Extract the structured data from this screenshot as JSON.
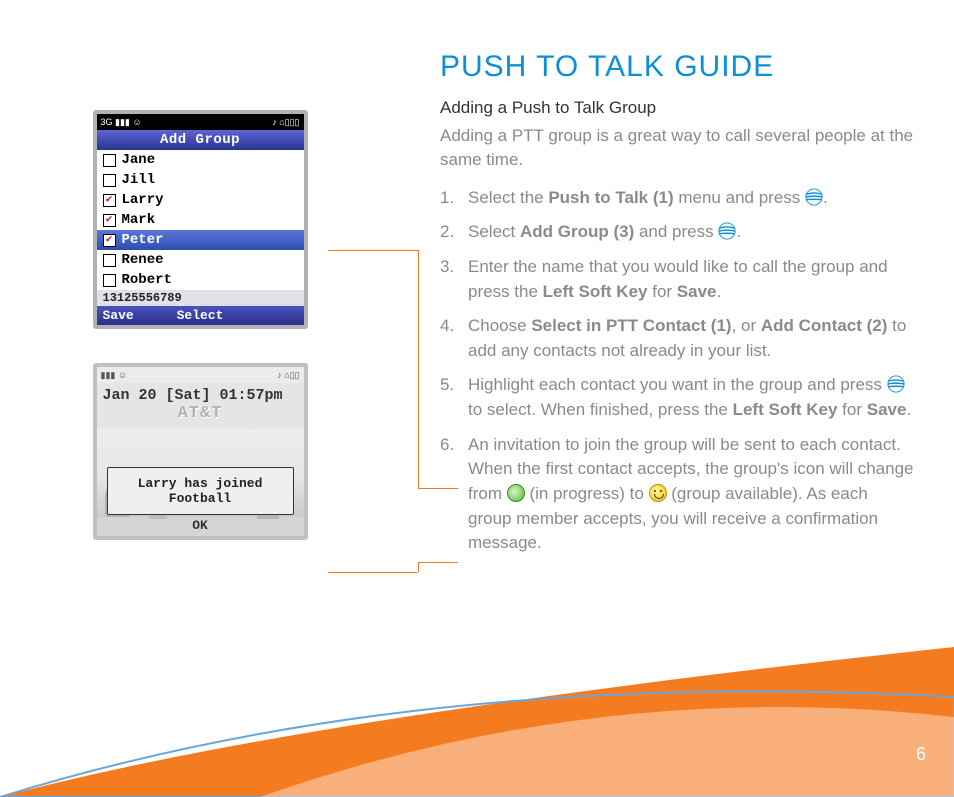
{
  "title": "PUSH TO TALK GUIDE",
  "subtitle": "Adding a Push to Talk Group",
  "intro": "Adding a PTT group is a great way to call several people at the same time.",
  "page_number": "6",
  "steps": {
    "s1a": "Select the ",
    "s1b": "Push to Talk (1)",
    "s1c": " menu and press ",
    "s1d": ".",
    "s2a": "Select ",
    "s2b": "Add Group (3)",
    "s2c": " and press ",
    "s2d": ".",
    "s3a": "Enter the name that you would like to call the group and press the ",
    "s3b": "Left Soft Key",
    "s3c": " for ",
    "s3d": "Save",
    "s3e": ".",
    "s4a": "Choose ",
    "s4b": "Select in PTT Contact (1)",
    "s4c": ", or ",
    "s4d": "Add Contact (2)",
    "s4e": " to add any contacts not already in your list.",
    "s5a": "Highlight each contact you want in the group and press ",
    "s5b": " to select. When finished, press the ",
    "s5c": "Left Soft Key",
    "s5d": " for ",
    "s5e": "Save",
    "s5f": ".",
    "s6a": "An invitation to join the group will be sent to each contact. When the first contact accepts, the group's icon will change from ",
    "s6b": " (in progress) to ",
    "s6c": " (group available). As each group member accepts, you will receive a confirmation message."
  },
  "phone1": {
    "header": "Add Group",
    "status_left": "3G ▮▮▮  ☺",
    "status_right": "♪  ⌂▯▯▯",
    "items": [
      {
        "name": "Jane",
        "checked": false,
        "selected": false
      },
      {
        "name": "Jill",
        "checked": false,
        "selected": false
      },
      {
        "name": "Larry",
        "checked": true,
        "selected": false
      },
      {
        "name": "Mark",
        "checked": true,
        "selected": false
      },
      {
        "name": "Peter",
        "checked": true,
        "selected": true
      },
      {
        "name": "Renee",
        "checked": false,
        "selected": false
      },
      {
        "name": "Robert",
        "checked": false,
        "selected": false
      }
    ],
    "footer_number": "13125556789",
    "softkey_left": "Save",
    "softkey_center": "Select",
    "softkey_right": ""
  },
  "phone2": {
    "status_left": "▮▮▮  ☺",
    "status_right": "♪  ⌂▯▯",
    "datetime": "Jan 20 [Sat] 01:57pm",
    "carrier": "AT&T",
    "popup_line1": "Larry has joined",
    "popup_line2": "Football",
    "softkey": "OK"
  },
  "icons": {
    "att": "att-globe-icon",
    "progress": "in-progress-icon",
    "available": "group-available-icon"
  }
}
